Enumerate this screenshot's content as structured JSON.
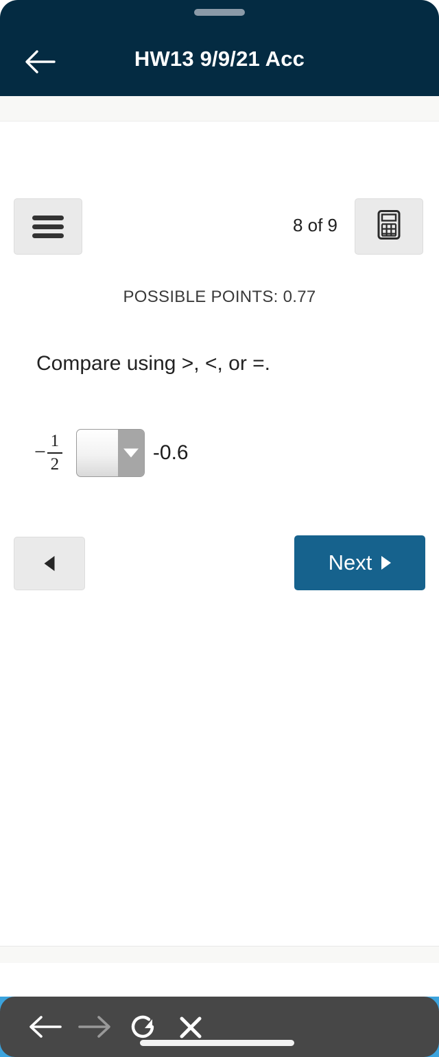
{
  "header": {
    "title": "HW13 9/9/21 Acc",
    "back_icon": "back-arrow-icon",
    "drag_handle": "drag-handle",
    "background_color": "#042b42"
  },
  "toolbar": {
    "menu_icon": "hamburger-menu-icon",
    "calculator_icon": "calculator-icon",
    "counter": "8 of 9"
  },
  "question": {
    "possible_points": "POSSIBLE POINTS: 0.77",
    "prompt": "Compare using >, <, or =.",
    "left_operand": {
      "sign": "−",
      "numerator": "1",
      "denominator": "2"
    },
    "comparison_select": {
      "value": "",
      "placeholder": "",
      "options": [
        ">",
        "<",
        "="
      ],
      "arrow_icon": "chevron-down-icon"
    },
    "right_operand": "-0.6"
  },
  "navigation": {
    "previous_label": "",
    "previous_icon": "triangle-left-icon",
    "next_label": "Next",
    "next_icon": "triangle-right-icon",
    "next_color": "#16628d"
  },
  "browser_bar": {
    "back_icon": "arrow-left-icon",
    "forward_icon": "arrow-right-icon",
    "reload_icon": "reload-icon",
    "close_icon": "close-x-icon",
    "home_indicator": "home-indicator",
    "background_color": "#474747"
  }
}
